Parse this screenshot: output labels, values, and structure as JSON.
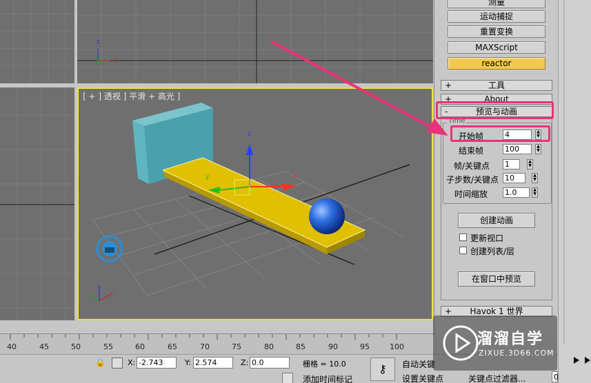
{
  "panel": {
    "buttons": [
      "测量",
      "运动捕捉",
      "重置变换",
      "MAXScript",
      "reactor"
    ],
    "active_button": "reactor",
    "rollouts": {
      "tools": {
        "sign": "+",
        "label": "工具"
      },
      "about": {
        "sign": "+",
        "label": "About"
      },
      "preview": {
        "sign": "-",
        "label": "预览与动画"
      },
      "havok": {
        "sign": "+",
        "label": "Havok 1 世界"
      }
    },
    "group_label": "Time",
    "fields": [
      {
        "label": "开始帧",
        "value": "4"
      },
      {
        "label": "结束帧",
        "value": "100"
      },
      {
        "label": "帧/关键点",
        "value": "1"
      },
      {
        "label": "子步数/关键点",
        "value": "10"
      },
      {
        "label": "时间缩放",
        "value": "1.0"
      }
    ],
    "create_animation": "创建动画",
    "checkboxes": [
      {
        "label": "更新视口",
        "checked": false
      },
      {
        "label": "创建列表/层",
        "checked": false
      }
    ],
    "preview_in_window": "在窗口中预览"
  },
  "viewport": {
    "label": "[ + ] 透视 ] 平滑 + 高光 ]",
    "axis_x": "x",
    "axis_y": "y",
    "axis_z": "z"
  },
  "timeline": {
    "ticks": [
      "40",
      "45",
      "50",
      "55",
      "60",
      "65",
      "70",
      "75",
      "80",
      "85",
      "90",
      "95",
      "100"
    ]
  },
  "status": {
    "x_label": "X:",
    "x_value": "-2.743",
    "y_label": "Y:",
    "y_value": "2.574",
    "z_label": "Z:",
    "z_value": "0.0",
    "grid": "栅格 = 10.0",
    "auto_key": "自动关键",
    "set_key": "设置关键点",
    "key_filters": "关键点过滤器...",
    "add_time_tag": "添加时间标记",
    "frame_value": "0"
  },
  "watermark": {
    "brand": "溜溜自学",
    "url": "ZIXUE.3D66.COM"
  },
  "colors": {
    "highlight": "#e8337a",
    "viewport_bg": "#6f6f6f",
    "active_border": "#f0e040",
    "reactor": "#f2c94c"
  }
}
